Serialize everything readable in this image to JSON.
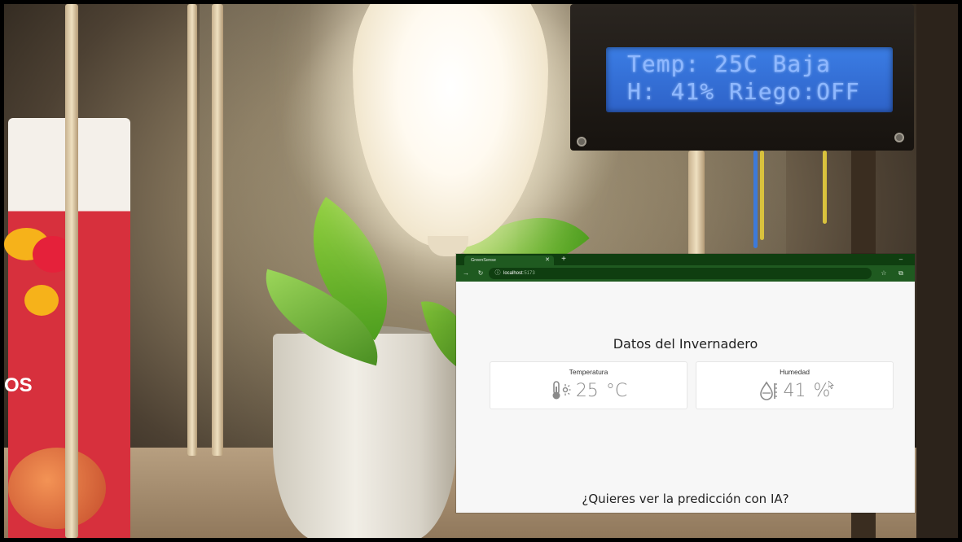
{
  "lcd": {
    "line1": "Temp: 25C Baja",
    "line2": "H: 41% Riego:OFF"
  },
  "browser": {
    "tab_title": "GreenSense",
    "tab_close_icon": "close-icon",
    "new_tab_label": "+",
    "address": {
      "host": "localhost",
      "port": ":5173"
    }
  },
  "page": {
    "title": "Datos del Invernadero",
    "cards": [
      {
        "label": "Temperatura",
        "icon": "thermometer-sun-icon",
        "value": "25",
        "unit": "°C"
      },
      {
        "label": "Humedad",
        "icon": "water-drop-gauge-icon",
        "value": "41",
        "unit": "%"
      }
    ],
    "cta": "¿Quieres ver la predicción con IA?"
  },
  "colors": {
    "tabbar": "#0f3e10",
    "toolbar": "#1f5a20",
    "page_bg": "#f7f7f7",
    "lcd_bg": "#3b7de4"
  }
}
